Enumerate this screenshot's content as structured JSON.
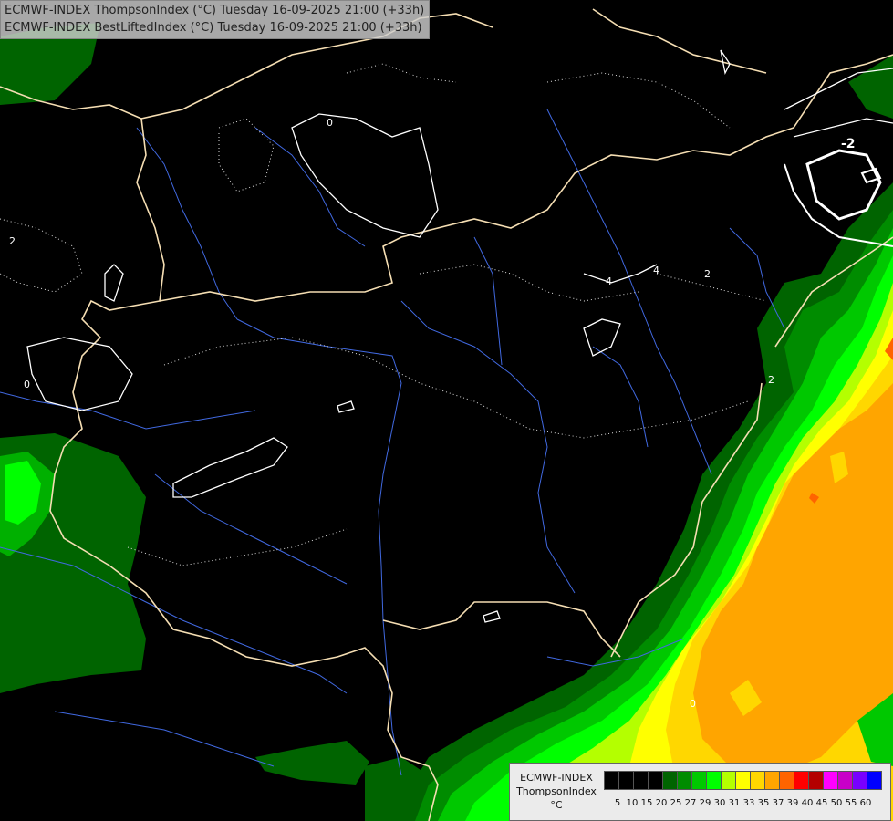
{
  "header": {
    "line1": "ECMWF-INDEX ThompsonIndex (°C) Tuesday 16-09-2025 21:00 (+33h)",
    "line2": "ECMWF-INDEX BestLiftedIndex (°C) Tuesday 16-09-2025 21:00 (+33h)"
  },
  "legend": {
    "title1": "ECMWF-INDEX",
    "title2": "ThompsonIndex",
    "unit": "°C",
    "ticks": [
      "5",
      "10",
      "15",
      "20",
      "25",
      "27",
      "29",
      "30",
      "31",
      "33",
      "35",
      "37",
      "39",
      "40",
      "45",
      "50",
      "55",
      "60"
    ],
    "colors": [
      "#000000",
      "#000000",
      "#000000",
      "#000000",
      "#006400",
      "#008c00",
      "#00c800",
      "#00ff00",
      "#b4ff00",
      "#ffff00",
      "#ffd700",
      "#ffa500",
      "#ff6400",
      "#ff0000",
      "#b40000",
      "#ff00ff",
      "#c800c8",
      "#7800ff",
      "#0000ff"
    ]
  },
  "contour_labels": [
    "0",
    "-2",
    "2",
    "4",
    "4",
    "2",
    "0",
    "2",
    "0"
  ],
  "colors": {
    "background": "#000000",
    "borders": "#f5deb3",
    "rivers": "#4169e1",
    "contours": "#ffffff"
  }
}
